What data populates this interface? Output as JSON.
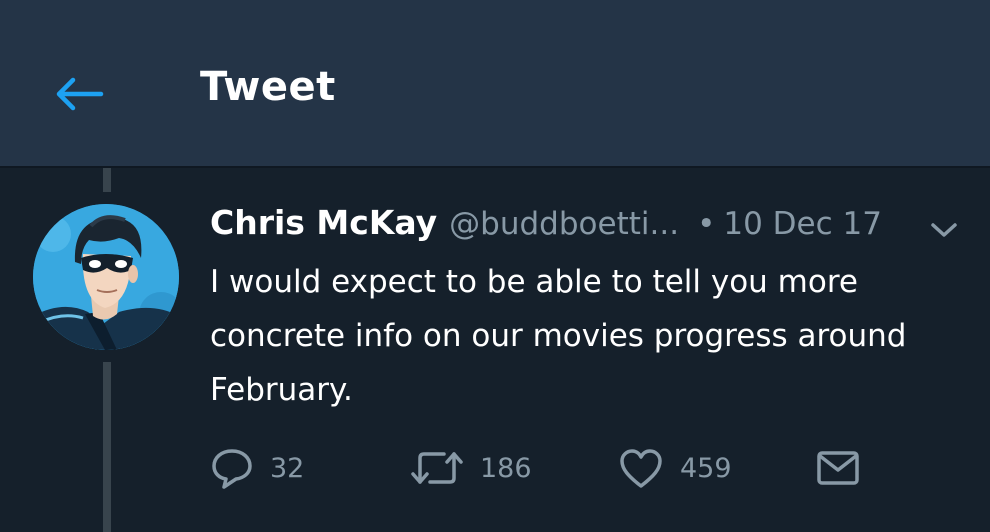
{
  "header": {
    "title": "Tweet",
    "back_icon": "arrow-left-icon",
    "accent_color": "#1da1f2"
  },
  "tweet": {
    "author": {
      "display_name": "Chris McKay",
      "handle": "@buddboetti...",
      "avatar": "nightwing-avatar"
    },
    "separator": "•",
    "timestamp": "10 Dec 17",
    "menu_icon": "chevron-down-icon",
    "text": "I would expect to be able to tell you more concrete info on our movies progress around February.",
    "actions": {
      "reply": {
        "icon": "reply-icon",
        "count": "32"
      },
      "retweet": {
        "icon": "retweet-icon",
        "count": "186"
      },
      "like": {
        "icon": "heart-icon",
        "count": "459"
      },
      "direct_message": {
        "icon": "envelope-icon"
      }
    }
  },
  "colors": {
    "background": "#15202b",
    "header_background": "#243447",
    "text_primary": "#ffffff",
    "text_secondary": "#8899a6",
    "thread_line": "#38444d"
  }
}
